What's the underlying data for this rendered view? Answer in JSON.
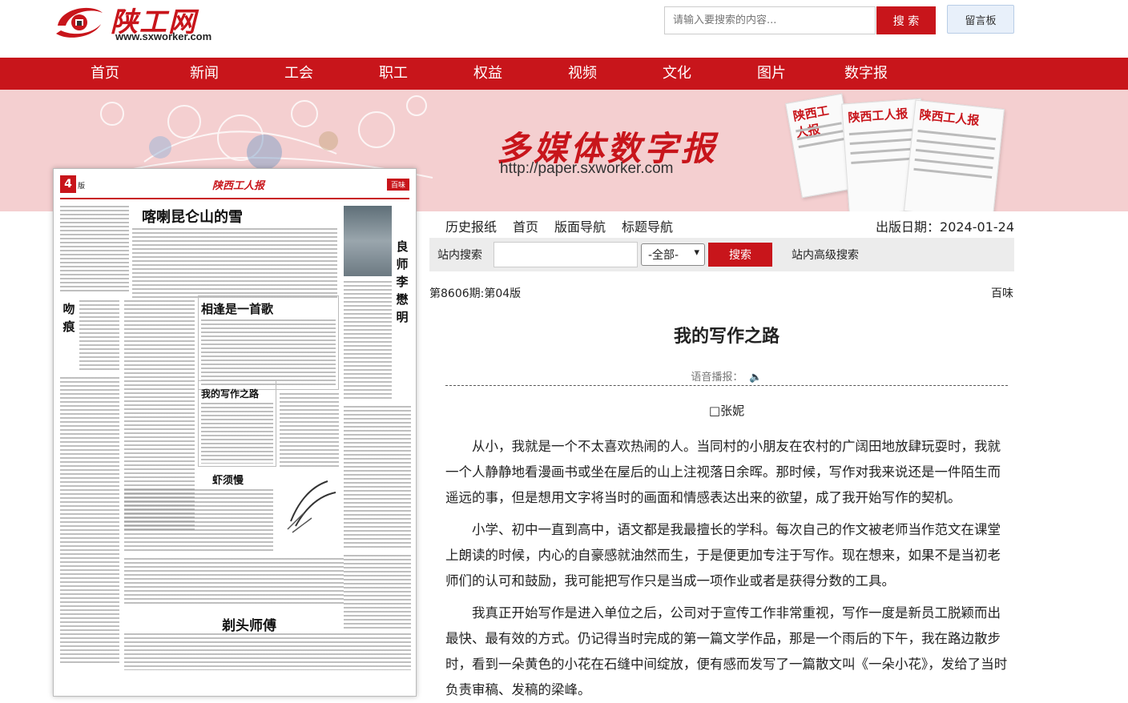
{
  "site": {
    "logo_text": "陕工网",
    "logo_url": "www.sxworker.com"
  },
  "header": {
    "search_placeholder": "请输入要搜索的内容...",
    "search_button": "搜 索",
    "message_board": "留言板"
  },
  "nav": {
    "items": [
      "首页",
      "新闻",
      "工会",
      "职工",
      "权益",
      "视频",
      "文化",
      "图片",
      "数字报"
    ]
  },
  "banner": {
    "title": "多媒体数字报",
    "url": "http://paper.sxworker.com",
    "newspaper_masthead": "陕西工人报"
  },
  "paper_thumb": {
    "page_num": "4",
    "page_num_suffix": "版",
    "masthead": "陕西工人报",
    "section": "百味",
    "headlines": [
      "喀喇昆仑山的雪",
      "相逢是一首歌",
      "我的写作之路",
      "虾须慢",
      "剃头师傅"
    ],
    "vertical_title_left": "吻痕",
    "vertical_title_right": "良师李懋明"
  },
  "toolbar": {
    "links": [
      "历史报纸",
      "首页",
      "版面导航",
      "标题导航"
    ],
    "pubdate_label": "出版日期：",
    "pubdate": "2024-01-24"
  },
  "site_search": {
    "label": "站内搜索",
    "scope": "-全部-",
    "button": "搜索",
    "advanced": "站内高级搜索"
  },
  "article": {
    "issue": "第8606期:第04版",
    "column": "百味",
    "title": "我的写作之路",
    "voice_label": "语音播报：",
    "author": "□张妮",
    "paragraphs": [
      "从小，我就是一个不太喜欢热闹的人。当同村的小朋友在农村的广阔田地放肆玩耍时，我就一个人静静地看漫画书或坐在屋后的山上注视落日余晖。那时候，写作对我来说还是一件陌生而遥远的事，但是想用文字将当时的画面和情感表达出来的欲望，成了我开始写作的契机。",
      "小学、初中一直到高中，语文都是我最擅长的学科。每次自己的作文被老师当作范文在课堂上朗读的时候，内心的自豪感就油然而生，于是便更加专注于写作。现在想来，如果不是当初老师们的认可和鼓励，我可能把写作只是当成一项作业或者是获得分数的工具。",
      "我真正开始写作是进入单位之后，公司对于宣传工作非常重视，写作一度是新员工脱颖而出最快、最有效的方式。仍记得当时完成的第一篇文学作品，那是一个雨后的下午，我在路边散步时，看到一朵黄色的小花在石缝中间绽放，便有感而发写了一篇散文叫《一朵小花》，发给了当时负责审稿、发稿的梁峰。"
    ]
  },
  "colors": {
    "brand_red": "#c8151b",
    "banner_pink": "#f4cfd0"
  }
}
